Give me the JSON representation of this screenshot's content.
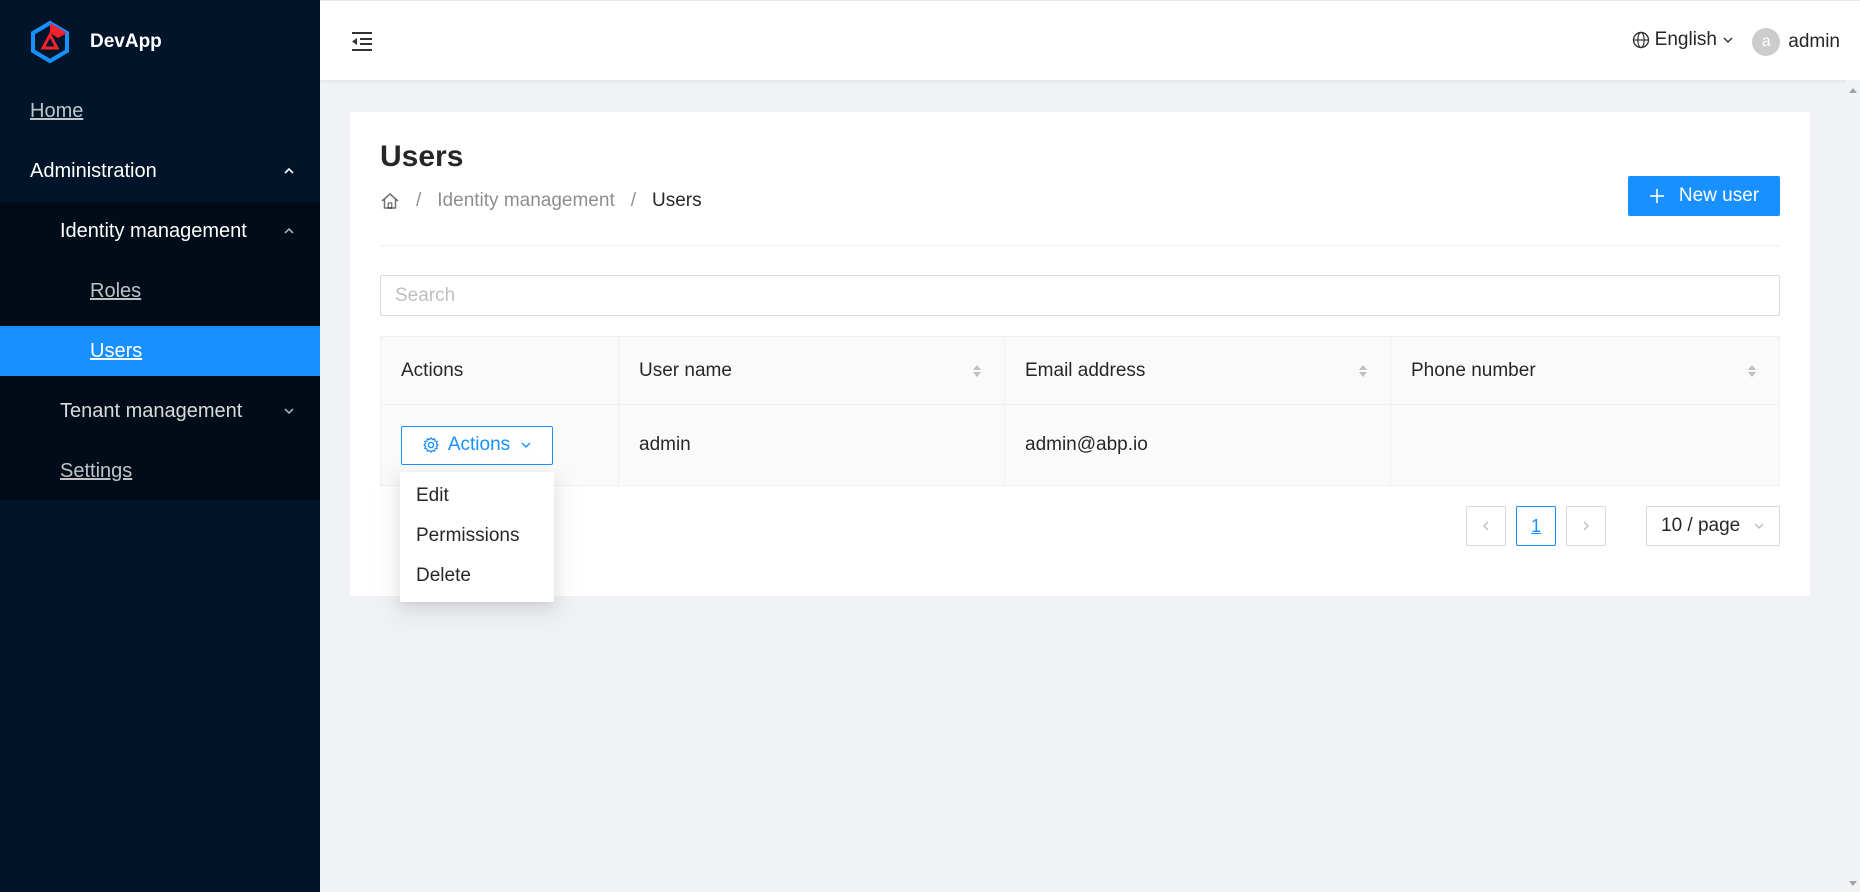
{
  "app": {
    "name": "DevApp"
  },
  "sidebar": {
    "home": "Home",
    "administration": "Administration",
    "identity_management": "Identity management",
    "roles": "Roles",
    "users": "Users",
    "tenant_management": "Tenant management",
    "settings": "Settings",
    "selected": "Users"
  },
  "header": {
    "language": "English",
    "user": "admin",
    "avatar_letter": "a"
  },
  "page": {
    "title": "Users",
    "breadcrumb": [
      "Identity management",
      "Users"
    ],
    "new_user_label": "New user",
    "search_placeholder": "Search"
  },
  "table": {
    "columns": [
      "Actions",
      "User name",
      "Email address",
      "Phone number"
    ],
    "rows": [
      {
        "actions_label": "Actions",
        "user_name": "admin",
        "email": "admin@abp.io",
        "phone": ""
      }
    ]
  },
  "dropdown": {
    "items": [
      "Edit",
      "Permissions",
      "Delete"
    ]
  },
  "pagination": {
    "current_page": "1",
    "page_size": "10 / page"
  },
  "colors": {
    "primary": "#1890ff",
    "sidebar": "#001529",
    "submenu": "#000c17"
  },
  "icons": [
    "app-logo-icon",
    "chevron-up-icon",
    "chevron-down-icon",
    "menu-fold-icon",
    "globe-icon",
    "home-icon",
    "plus-icon",
    "gear-icon",
    "sort-icon",
    "left-icon",
    "right-icon"
  ]
}
